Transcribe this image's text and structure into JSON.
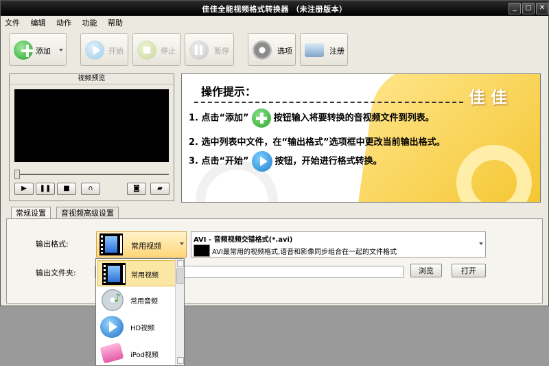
{
  "window": {
    "title": "佳佳全能视频格式转换器 （未注册版本）"
  },
  "menu": [
    "文件",
    "编辑",
    "动作",
    "功能",
    "帮助"
  ],
  "toolbar": {
    "add_label": "添加",
    "start_label": "开始",
    "stop_label": "停止",
    "pause_label": "暂停",
    "options_label": "选项",
    "register_label": "注册"
  },
  "preview": {
    "title": "视频预览"
  },
  "tips": {
    "heading": "操作提示：",
    "brand": "佳佳",
    "line1_prefix": "1. 点击“添加”",
    "line1_suffix": "按钮输入将要转换的音视频文件到列表。",
    "line2": "2. 选中列表中文件，在“输出格式”选项框中更改当前输出格式。",
    "line3_prefix": "3. 点击“开始”",
    "line3_suffix": "按钮，开始进行格式转换。"
  },
  "tabs": [
    "常规设置",
    "音视频高级设置"
  ],
  "settings": {
    "output_format_label": "输出格式:",
    "output_folder_label": "输出文件夹:",
    "category_selected": "常用视频",
    "format_title": "AVI - 音频视频交错格式(*.avi)",
    "format_desc": "AVI最常用的视频格式,语音和影像同步组合在一起的文件格式",
    "browse_label": "浏览",
    "open_label": "打开"
  },
  "dropdown_options": [
    "常用视频",
    "常用音频",
    "HD视频",
    "iPod视频"
  ],
  "colors": {
    "accent": "#f4c52e",
    "titlebar": "#111111"
  }
}
